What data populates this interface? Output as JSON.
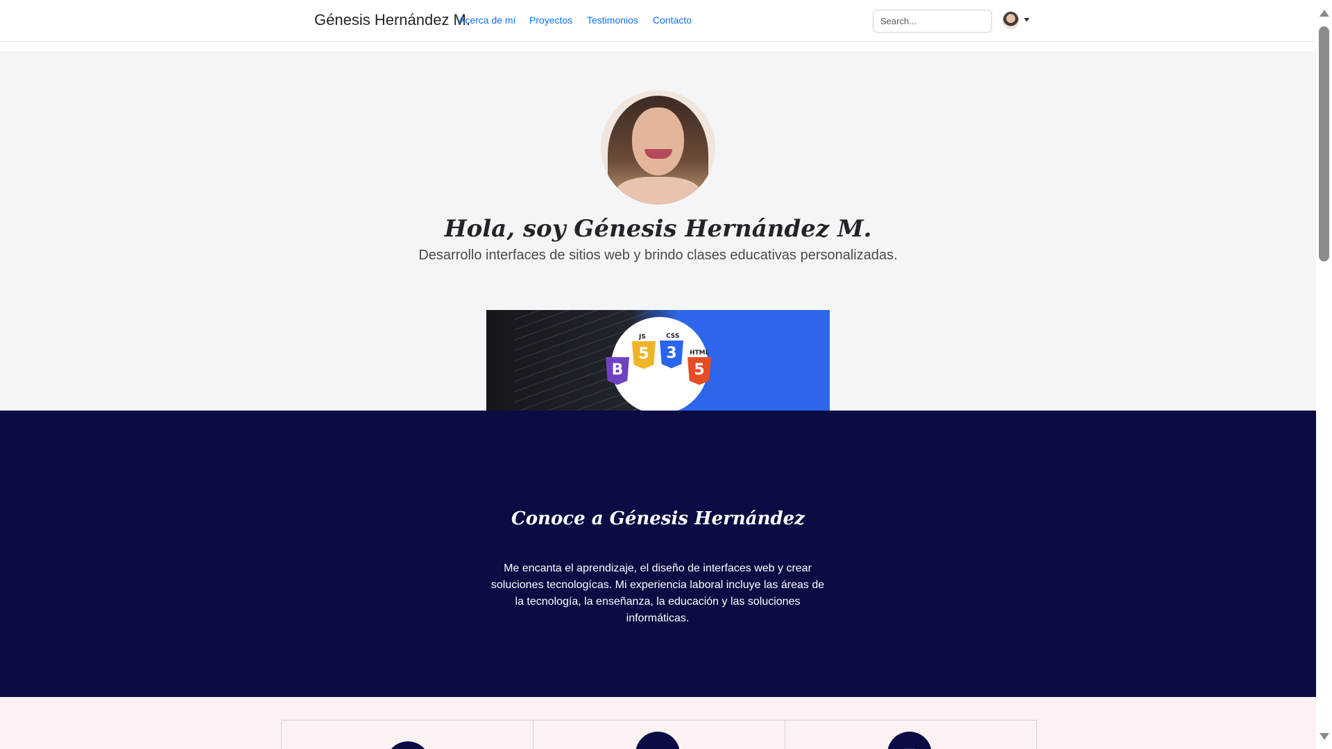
{
  "navbar": {
    "brand": "Génesis Hernández M.",
    "links": [
      {
        "label": "Acerca de mí"
      },
      {
        "label": "Proyectos"
      },
      {
        "label": "Testimonios"
      },
      {
        "label": "Contacto"
      }
    ],
    "search": {
      "placeholder": "Search...",
      "value": ""
    },
    "avatar_icon": "user-avatar"
  },
  "hero": {
    "title": "Hola, soy Génesis Hernández M.",
    "subtitle": "Desarrollo interfaces de sitios web y brindo clases educativas personalizadas.",
    "banner_badges": [
      {
        "letter": "B",
        "color": "#6f42c1"
      },
      {
        "letter": "5",
        "label": "JS",
        "color": "#f0b429"
      },
      {
        "letter": "3",
        "label": "CSS",
        "color": "#2965f1"
      },
      {
        "letter": "5",
        "label": "HTML",
        "color": "#e44d26"
      }
    ]
  },
  "about": {
    "title": "Conoce a Génesis Hernández",
    "text": "Me encanta el aprendizaje, el diseño de interfaces web y crear soluciones tecnologícas. Mi experiencia laboral incluye las áreas de la tecnología, la enseñanza, la educación y las soluciones informáticas."
  },
  "services": {
    "cards": [
      {
        "icon": "circle-icon"
      },
      {
        "icon": "laptop-icon"
      },
      {
        "icon": "book-icon"
      }
    ]
  },
  "colors": {
    "navy": "#0a0c43",
    "link": "#0d6efd",
    "hero_bg": "#f4f5f7",
    "services_bg": "#fcf2f2"
  }
}
